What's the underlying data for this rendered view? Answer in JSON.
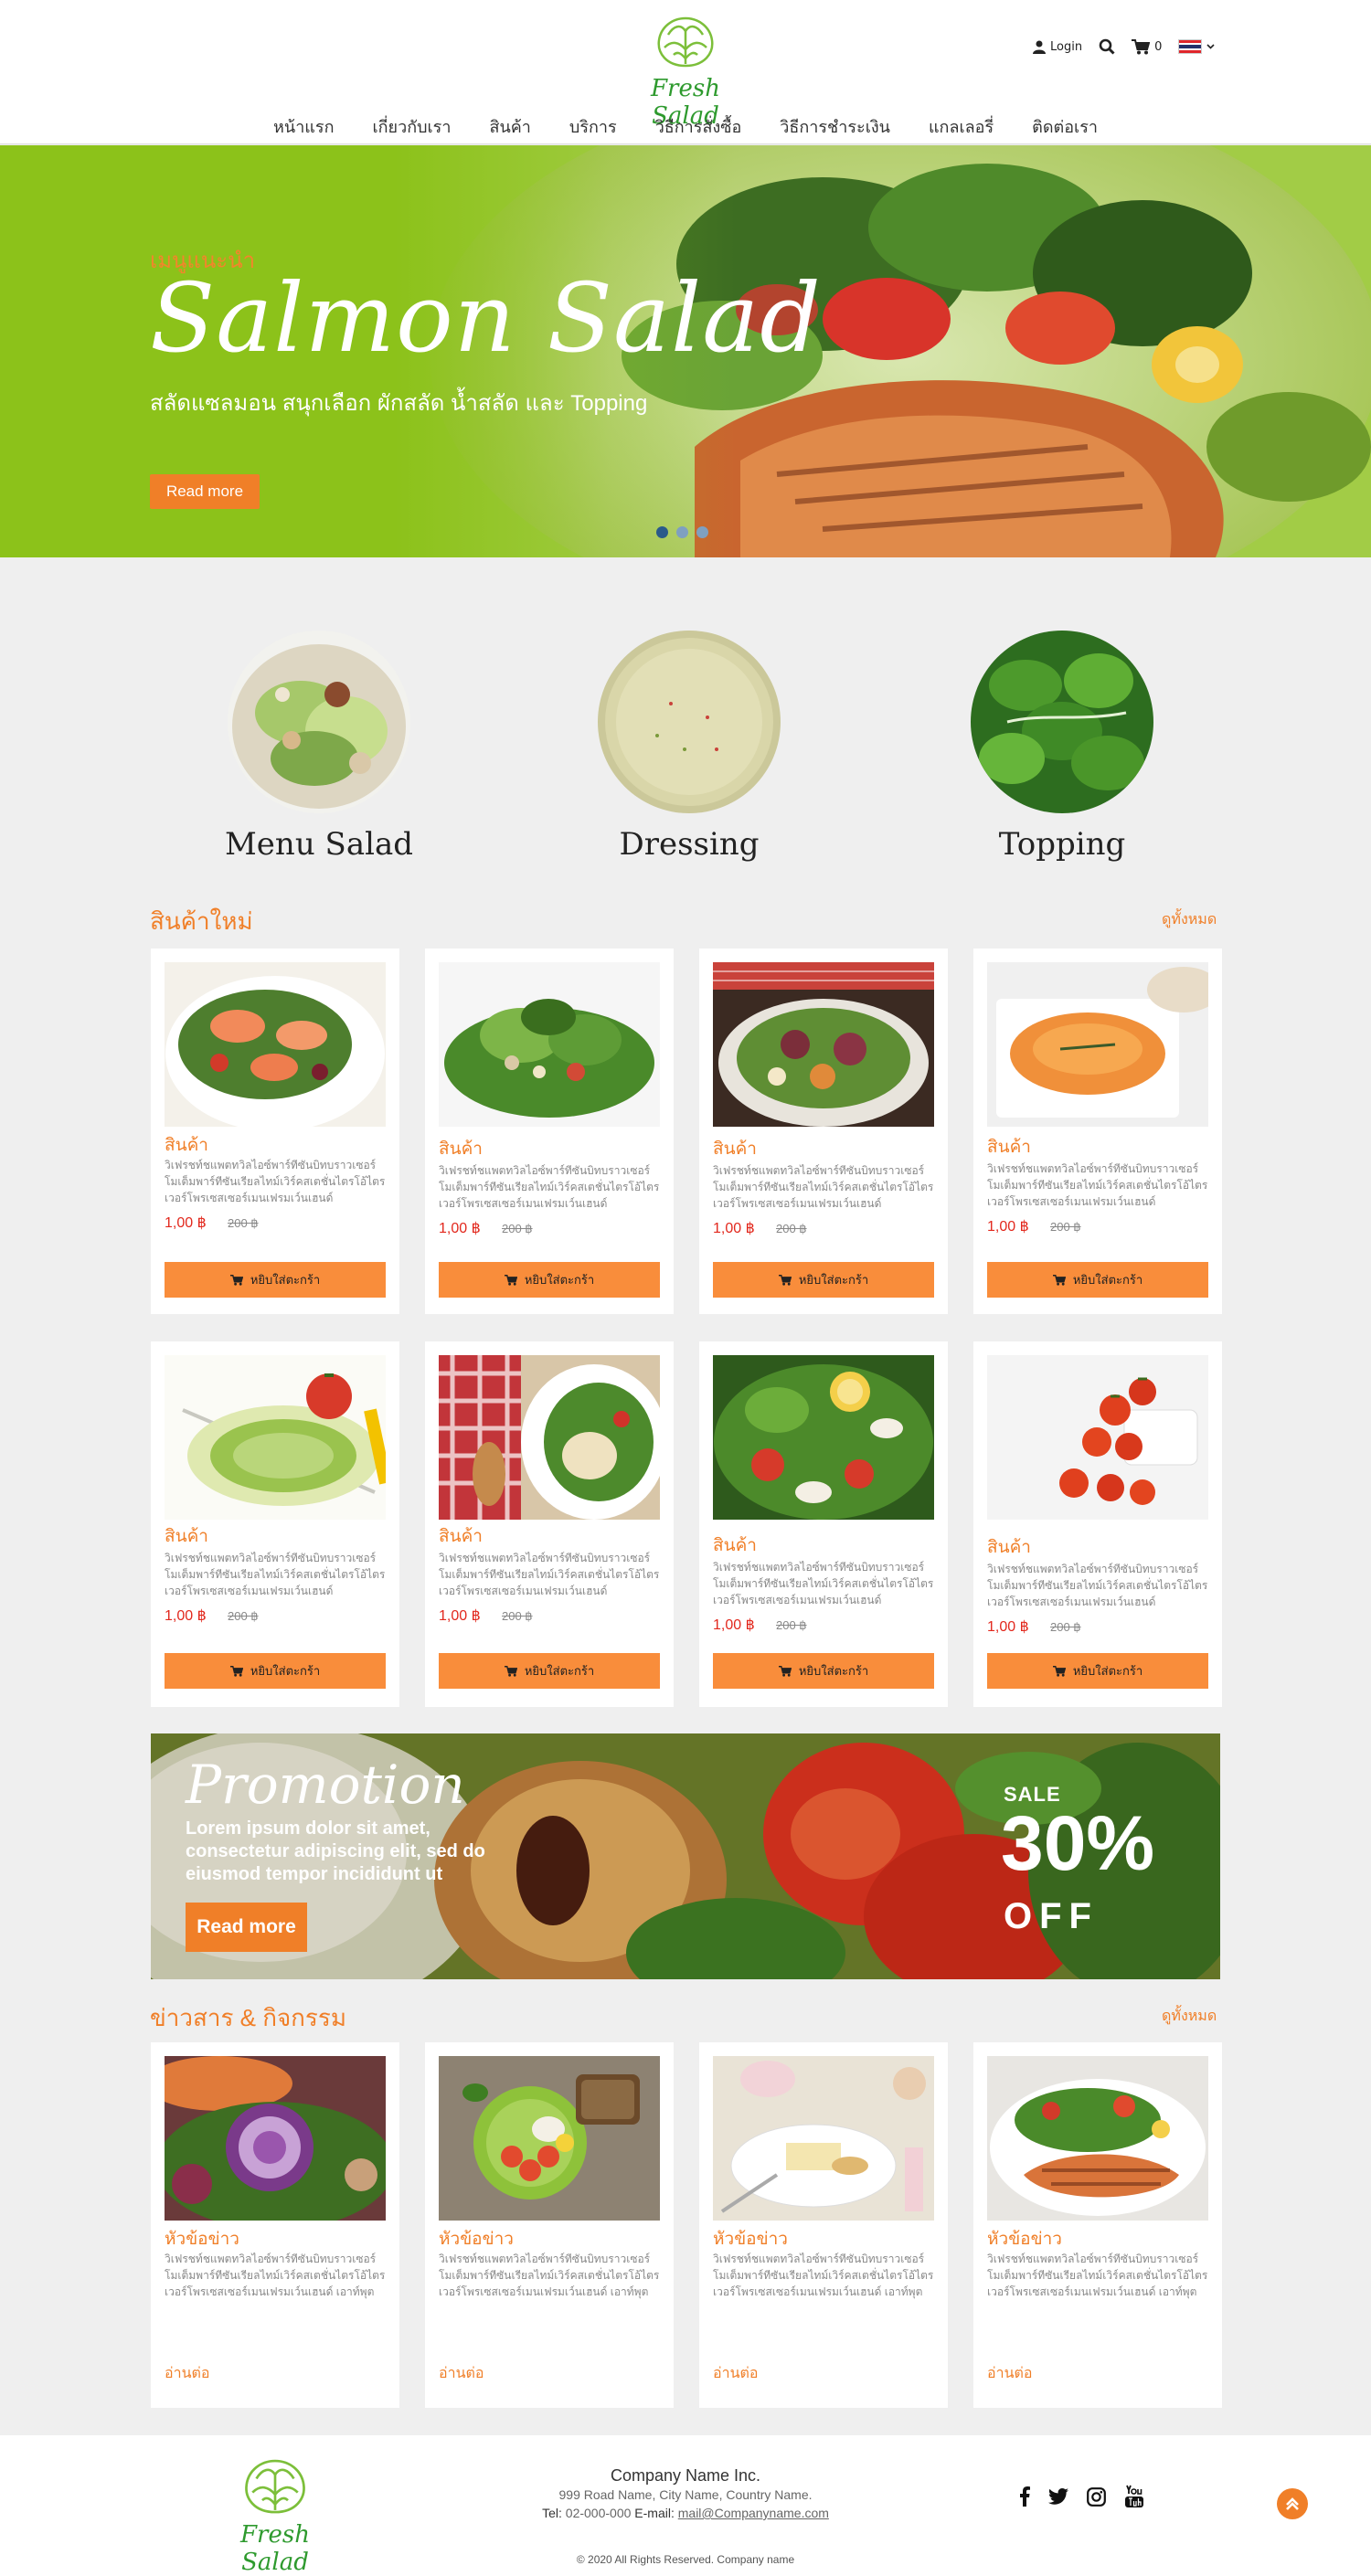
{
  "brand": {
    "name": "Fresh Salad"
  },
  "header": {
    "login_label": "Login",
    "cart_count": "0",
    "nav": [
      "หน้าแรก",
      "เกี่ยวกับเรา",
      "สินค้า",
      "บริการ",
      "วิธีการสั่งซื้อ",
      "วิธีการชำระเงิน",
      "แกลเลอรี่",
      "ติดต่อเรา"
    ]
  },
  "hero": {
    "kicker": "เมนูแนะนำ",
    "title": "Salmon Salad",
    "subtitle": "สลัดแซลมอน สนุกเลือก ผักสลัด น้ำสลัด และ Topping",
    "button": "Read more",
    "slide_count": 3,
    "active_slide": 1
  },
  "categories": [
    "Menu Salad",
    "Dressing",
    "Topping"
  ],
  "new_products": {
    "heading": "สินค้าใหม่",
    "view_all": "ดูทั้งหมด",
    "items": [
      {
        "title": "สินค้า",
        "desc": "วิเฟรชท์ชแพตทวิลไอซ์พาร์ทีซันบิทบราวเซอร์โมเต็มพาร์ทีซันเรียลไทม์เวิร์คสเตชั่นไตรโอ้ไตรเวอร์โพรเซสเซอร์เมนเฟรมเว์นเฮนด์",
        "price": "1,00 ฿",
        "old_price": "200 ฿",
        "button": "หยิบใส่ตะกร้า"
      },
      {
        "title": "สินค้า",
        "desc": "วิเฟรชท์ชแพตทวิลไอซ์พาร์ทีซันบิทบราวเซอร์โมเต็มพาร์ทีซันเรียลไทม์เวิร์คสเตชั่นไตรโอ้ไตรเวอร์โพรเซสเซอร์เมนเฟรมเว์นเฮนด์",
        "price": "1,00 ฿",
        "old_price": "200 ฿",
        "button": "หยิบใส่ตะกร้า"
      },
      {
        "title": "สินค้า",
        "desc": "วิเฟรชท์ชแพตทวิลไอซ์พาร์ทีซันบิทบราวเซอร์โมเต็มพาร์ทีซันเรียลไทม์เวิร์คสเตชั่นไตรโอ้ไตรเวอร์โพรเซสเซอร์เมนเฟรมเว์นเฮนด์",
        "price": "1,00 ฿",
        "old_price": "200 ฿",
        "button": "หยิบใส่ตะกร้า"
      },
      {
        "title": "สินค้า",
        "desc": "วิเฟรชท์ชแพตทวิลไอซ์พาร์ทีซันบิทบราวเซอร์โมเต็มพาร์ทีซันเรียลไทม์เวิร์คสเตชั่นไตรโอ้ไตรเวอร์โพรเซสเซอร์เมนเฟรมเว์นเฮนด์",
        "price": "1,00 ฿",
        "old_price": "200 ฿",
        "button": "หยิบใส่ตะกร้า"
      },
      {
        "title": "สินค้า",
        "desc": "วิเฟรชท์ชแพตทวิลไอซ์พาร์ทีซันบิทบราวเซอร์โมเต็มพาร์ทีซันเรียลไทม์เวิร์คสเตชั่นไตรโอ้ไตรเวอร์โพรเซสเซอร์เมนเฟรมเว์นเฮนด์",
        "price": "1,00 ฿",
        "old_price": "200 ฿",
        "button": "หยิบใส่ตะกร้า"
      },
      {
        "title": "สินค้า",
        "desc": "วิเฟรชท์ชแพตทวิลไอซ์พาร์ทีซันบิทบราวเซอร์โมเต็มพาร์ทีซันเรียลไทม์เวิร์คสเตชั่นไตรโอ้ไตรเวอร์โพรเซสเซอร์เมนเฟรมเว์นเฮนด์",
        "price": "1,00 ฿",
        "old_price": "200 ฿",
        "button": "หยิบใส่ตะกร้า"
      },
      {
        "title": "สินค้า",
        "desc": "วิเฟรชท์ชแพตทวิลไอซ์พาร์ทีซันบิทบราวเซอร์โมเต็มพาร์ทีซันเรียลไทม์เวิร์คสเตชั่นไตรโอ้ไตรเวอร์โพรเซสเซอร์เมนเฟรมเว์นเฮนด์",
        "price": "1,00 ฿",
        "old_price": "200 ฿",
        "button": "หยิบใส่ตะกร้า"
      },
      {
        "title": "สินค้า",
        "desc": "วิเฟรชท์ชแพตทวิลไอซ์พาร์ทีซันบิทบราวเซอร์โมเต็มพาร์ทีซันเรียลไทม์เวิร์คสเตชั่นไตรโอ้ไตรเวอร์โพรเซสเซอร์เมนเฟรมเว์นเฮนด์",
        "price": "1,00 ฿",
        "old_price": "200 ฿",
        "button": "หยิบใส่ตะกร้า"
      }
    ]
  },
  "promo": {
    "title": "Promotion",
    "text": "Lorem ipsum dolor sit amet, consectetur adipiscing elit, sed do eiusmod tempor incididunt ut",
    "button": "Read more",
    "sale_label": "SALE",
    "percent": "30%",
    "off_label": "OFF"
  },
  "news": {
    "heading": "ข่าวสาร & กิจกรรม",
    "view_all": "ดูทั้งหมด",
    "items": [
      {
        "title": "หัวข้อข่าว",
        "desc": "วิเฟรชท์ชแพตทวิลไอซ์พาร์ทีซันบิทบราวเซอร์โมเต็มพาร์ทีซันเรียลไทม์เวิร์คสเตชั่นไตรโอ้ไตรเวอร์โพรเซสเซอร์เมนเฟรมเว์นเฮนด์ เอาท์พุต",
        "read_more": "อ่านต่อ"
      },
      {
        "title": "หัวข้อข่าว",
        "desc": "วิเฟรชท์ชแพตทวิลไอซ์พาร์ทีซันบิทบราวเซอร์โมเต็มพาร์ทีซันเรียลไทม์เวิร์คสเตชั่นไตรโอ้ไตรเวอร์โพรเซสเซอร์เมนเฟรมเว์นเฮนด์ เอาท์พุต",
        "read_more": "อ่านต่อ"
      },
      {
        "title": "หัวข้อข่าว",
        "desc": "วิเฟรชท์ชแพตทวิลไอซ์พาร์ทีซันบิทบราวเซอร์โมเต็มพาร์ทีซันเรียลไทม์เวิร์คสเตชั่นไตรโอ้ไตรเวอร์โพรเซสเซอร์เมนเฟรมเว์นเฮนด์ เอาท์พุต",
        "read_more": "อ่านต่อ"
      },
      {
        "title": "หัวข้อข่าว",
        "desc": "วิเฟรชท์ชแพตทวิลไอซ์พาร์ทีซันบิทบราวเซอร์โมเต็มพาร์ทีซันเรียลไทม์เวิร์คสเตชั่นไตรโอ้ไตรเวอร์โพรเซสเซอร์เมนเฟรมเว์นเฮนด์ เอาท์พุต",
        "read_more": "อ่านต่อ"
      }
    ]
  },
  "footer": {
    "company": "Company Name Inc.",
    "address": "999 Road Name, City Name, Country Name.",
    "tel_label": "Tel:",
    "tel": "02-000-000",
    "email_label": "E-mail:",
    "email": "mail@Companyname.com",
    "copyright": "© 2020 All Rights Reserved. Company name",
    "social_icons": [
      "facebook-icon",
      "twitter-icon",
      "instagram-icon",
      "youtube-icon"
    ]
  },
  "colors": {
    "accent": "#f07f28",
    "hero_green": "#8cc21a",
    "brand_green": "#2e9a2e",
    "price_red": "#e2281d"
  }
}
